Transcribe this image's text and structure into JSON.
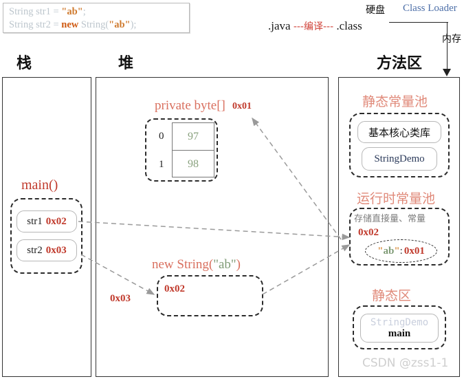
{
  "code_snippet": {
    "line1": {
      "prefix": "String str1 = ",
      "literal": "\"ab\"",
      "suffix": ";"
    },
    "line2": {
      "prefix": "String str2 = ",
      "keyword": "new",
      "mid": " String(",
      "literal": "\"ab\"",
      "suffix": ");"
    }
  },
  "pipeline": {
    "source": ".java",
    "compile_arrow": "---编译---",
    "classfile": ".class",
    "hard_disk_label": "硬盘",
    "class_loader_label": "Class Loader",
    "memory_label": "内存"
  },
  "columns": {
    "stack": {
      "header": "栈"
    },
    "heap": {
      "header": "堆"
    },
    "method_area": {
      "header": "方法区"
    }
  },
  "stack": {
    "frame_title": "main()",
    "variables": [
      {
        "name": "str1",
        "value": "0x02"
      },
      {
        "name": "str2",
        "value": "0x03"
      }
    ]
  },
  "heap": {
    "byte_array": {
      "title": "private byte[]",
      "address": "0x01",
      "rows": [
        {
          "index": "0",
          "value": "97"
        },
        {
          "index": "1",
          "value": "98"
        }
      ]
    },
    "new_string": {
      "title": "new String(\"ab\")",
      "title_prefix": "new String(",
      "title_literal": "\"ab\"",
      "title_suffix": ")",
      "address_inside": "0x02",
      "incoming_address": "0x03"
    }
  },
  "method_area": {
    "static_constant_pool": {
      "title": "静态常量池",
      "items": [
        {
          "label": "基本核心类库"
        },
        {
          "label": "StringDemo"
        }
      ]
    },
    "runtime_constant_pool": {
      "title": "运行时常量池",
      "note": "存储直接量、常量",
      "address": "0x02",
      "entry": {
        "key_quote_open": "\"",
        "key": "ab",
        "key_quote_close": "\"",
        "colon": ":",
        "value": "0x01"
      }
    },
    "static_area": {
      "title": "静态区",
      "class_label": "StringDemo",
      "method_label": "main"
    }
  },
  "watermark": "CSDN @zss1-1",
  "colors": {
    "accent_red": "#c0392b",
    "title_salmon": "#d9705f",
    "literal_orange": "#d78b3c",
    "value_green": "#8aa27f",
    "class_loader_blue": "#4d6fa8",
    "frame_border": "#333333"
  }
}
